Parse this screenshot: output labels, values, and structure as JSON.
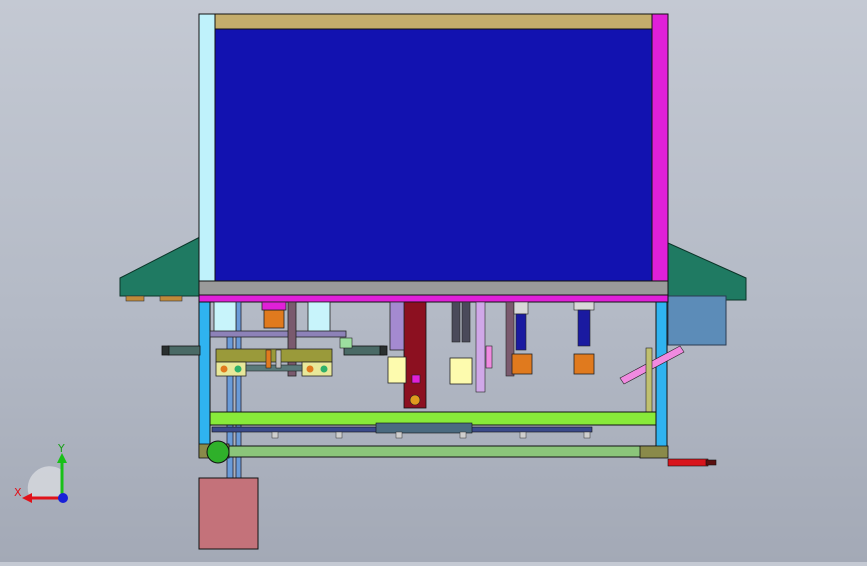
{
  "view": {
    "name": "cad-graphics-area",
    "projection": "front"
  },
  "triad": {
    "x_label": "X",
    "y_label": "Y",
    "x_color": "#e0121a",
    "y_color": "#18c018",
    "z_color": "#1820d8"
  },
  "colors": {
    "background": "#b8bdc8",
    "panel_blue": "#1212b0",
    "frame_magenta": "#e020d8",
    "frame_cyan": "#bff2fb",
    "top_beam": "#c4ad6c",
    "roof_teal": "#1f7a62",
    "column_blue": "#2fb3f0",
    "bar_green": "#88ea3a",
    "base_green": "#8bc57a",
    "cabinet_rose": "#c4727a",
    "gripper_orange": "#e07a1e",
    "cylinder_red": "#d8141c",
    "dark_red": "#8c1020"
  }
}
